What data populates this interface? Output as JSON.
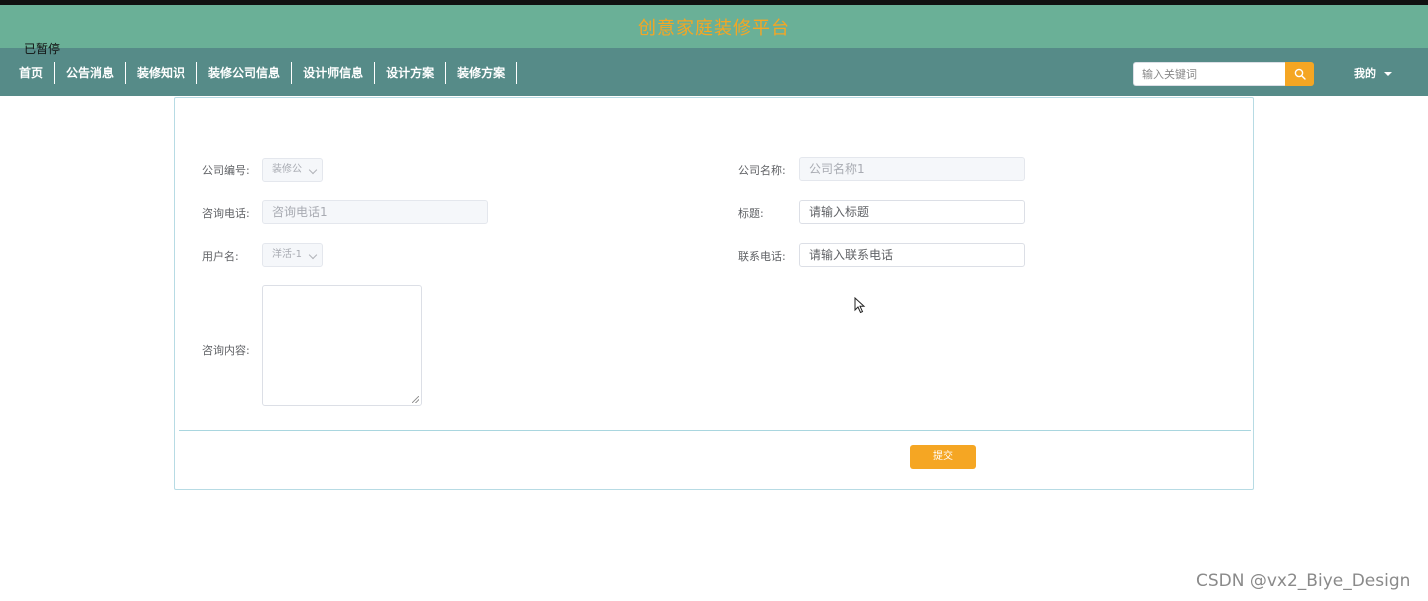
{
  "app": {
    "title": "创意家庭装修平台",
    "paused_label": "已暂停"
  },
  "nav": {
    "items": [
      "首页",
      "公告消息",
      "装修知识",
      "装修公司信息",
      "设计师信息",
      "设计方案",
      "装修方案"
    ],
    "search_placeholder": "输入关键词",
    "user_menu": "我的"
  },
  "form": {
    "company_no": {
      "label": "公司编号:",
      "value": "装修公"
    },
    "company_name": {
      "label": "公司名称:",
      "placeholder": "公司名称1"
    },
    "consult_phone": {
      "label": "咨询电话:",
      "placeholder": "咨询电话1"
    },
    "title": {
      "label": "标题:",
      "placeholder": "请输入标题"
    },
    "username": {
      "label": "用户名:",
      "value": "洋活-1"
    },
    "contact_phone": {
      "label": "联系电话:",
      "placeholder": "请输入联系电话"
    },
    "consult_content": {
      "label": "咨询内容:"
    },
    "submit_label": "提交"
  },
  "watermark": "CSDN @vx2_Biye_Design",
  "colors": {
    "header": "#6ab097",
    "nav": "#568b88",
    "accent": "#f5a623"
  }
}
